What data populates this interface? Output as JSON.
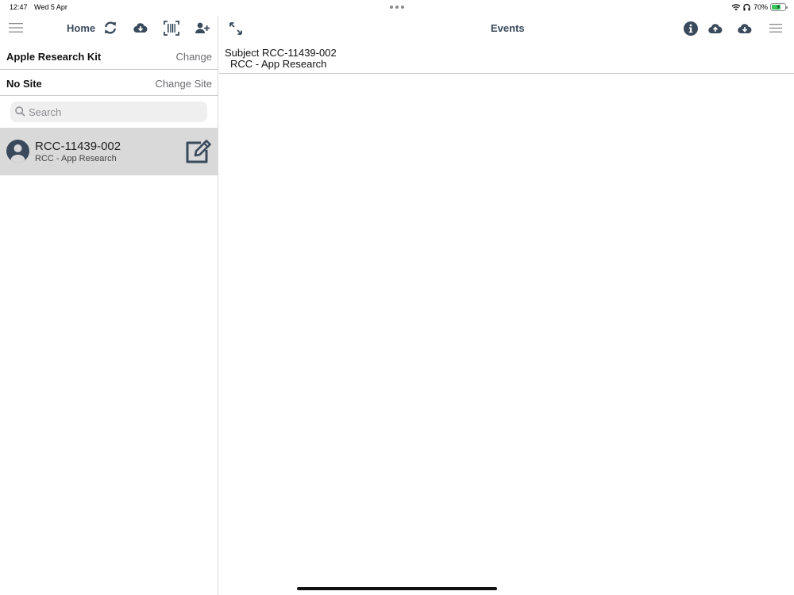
{
  "status_bar": {
    "time": "12:47",
    "date": "Wed 5 Apr",
    "battery": "70%",
    "icons": [
      "wifi-icon",
      "headphones-icon",
      "battery-icon"
    ]
  },
  "left_nav": {
    "title": "Home",
    "icons": [
      "hamburger-menu-icon",
      "refresh-icon",
      "cloud-download-icon",
      "barcode-scan-icon",
      "add-user-icon"
    ]
  },
  "study_row": {
    "label": "Apple Research Kit",
    "action": "Change"
  },
  "site_row": {
    "label": "No Site",
    "action": "Change Site"
  },
  "search": {
    "placeholder": "Search",
    "value": ""
  },
  "subjects": [
    {
      "id": "RCC-11439-002",
      "study": "RCC - App Research",
      "selected": true
    }
  ],
  "right_nav": {
    "title": "Events",
    "icons": [
      "expand-icon",
      "info-icon",
      "cloud-upload-icon",
      "cloud-download-icon",
      "hamburger-menu-icon"
    ]
  },
  "subject_header": {
    "line1": "Subject RCC-11439-002",
    "line2": "RCC - App Research"
  },
  "colors": {
    "icon": "#3a4a5c",
    "selected_row": "#d9d9d9",
    "divider": "#c8c8c8",
    "battery_fill": "#34c759"
  }
}
